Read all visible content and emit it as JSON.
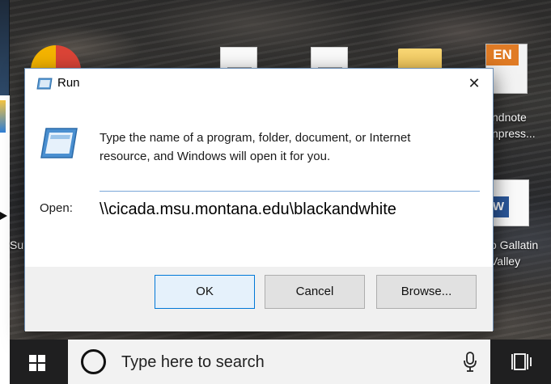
{
  "desktop": {
    "top_text": "",
    "icons": {
      "endnote_line1": "ndnote",
      "endnote_line2": "npress...",
      "left_partial": "Su",
      "gallatin_line1": "o Gallatin",
      "gallatin_line2": "Valley",
      "en_badge": "EN",
      "word_badge": "W"
    }
  },
  "dialog": {
    "title": "Run",
    "close_glyph": "✕",
    "description": "Type the name of a program, folder, document, or Internet resource, and Windows will open it for you.",
    "open_label": "Open:",
    "open_value": "\\\\cicada.msu.montana.edu\\blackandwhite",
    "buttons": {
      "ok": "OK",
      "cancel": "Cancel",
      "browse": "Browse..."
    }
  },
  "taskbar": {
    "search_placeholder": "Type here to search"
  },
  "icons": {
    "run_title": "run-icon",
    "run_large": "run-icon",
    "close": "close-icon",
    "windows": "windows-logo-icon",
    "cortana": "cortana-icon",
    "mic": "microphone-icon",
    "task_view": "task-view-icon"
  },
  "colors": {
    "dialog_border": "#6d8fb6",
    "input_underline": "#7aa7d8",
    "ok_border": "#0078d7",
    "taskbar": "#1f1f20"
  }
}
